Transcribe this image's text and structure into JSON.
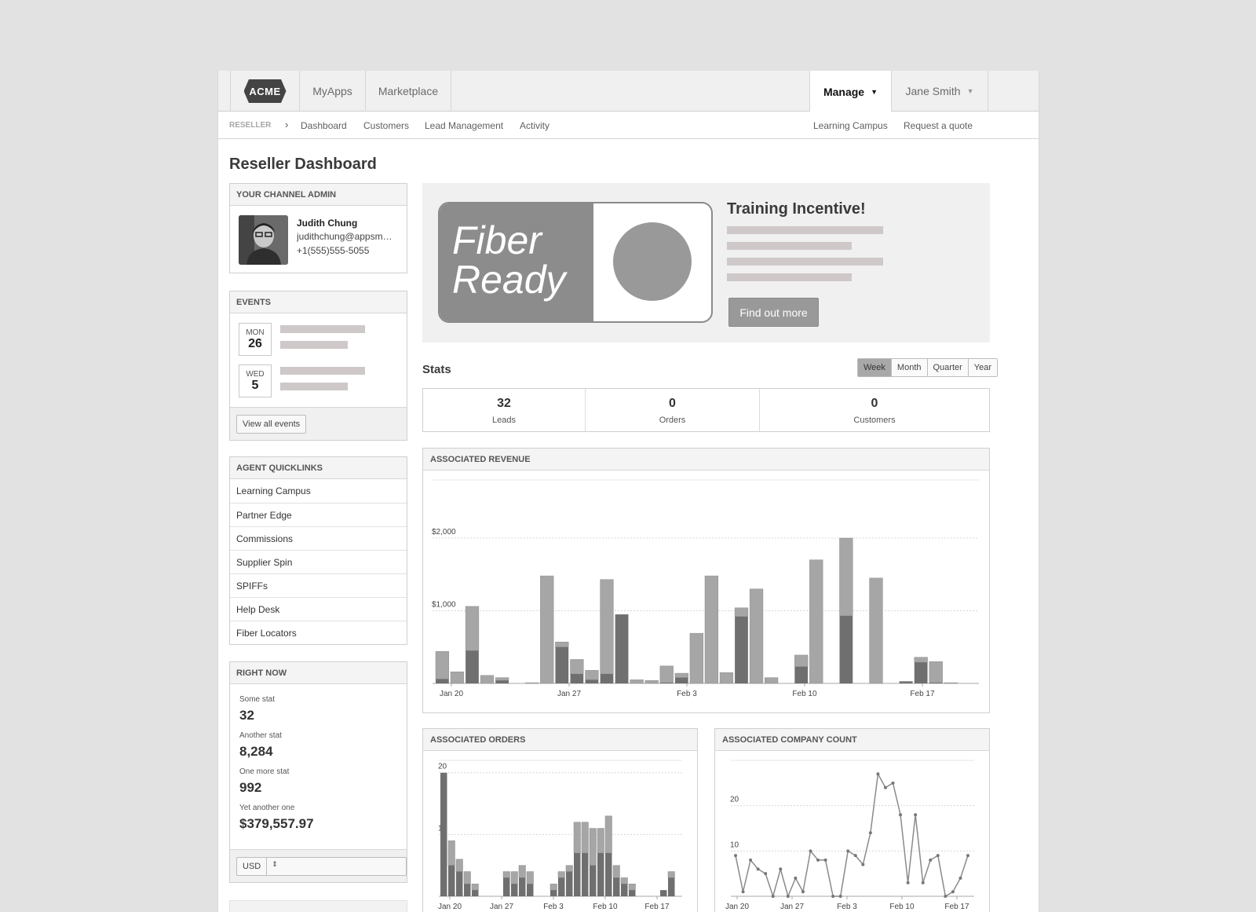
{
  "topnav": {
    "logo_text": "ACME",
    "tabs": [
      "MyApps",
      "Marketplace"
    ],
    "manage_label": "Manage",
    "user_label": "Jane Smith"
  },
  "subnav": {
    "section": "RESELLER",
    "items": [
      "Dashboard",
      "Customers",
      "Lead Management",
      "Activity"
    ],
    "right_links": [
      "Learning Campus",
      "Request a quote"
    ]
  },
  "page_title": "Reseller Dashboard",
  "channel_admin": {
    "heading": "YOUR CHANNEL ADMIN",
    "name": "Judith Chung",
    "email": "judithchung@appsm…",
    "phone": "+1(555)555-5055"
  },
  "events": {
    "heading": "EVENTS",
    "items": [
      {
        "weekday": "MON",
        "day": "26"
      },
      {
        "weekday": "WED",
        "day": "5"
      }
    ],
    "view_all_label": "View all events"
  },
  "quicklinks": {
    "heading": "AGENT QUICKLINKS",
    "items": [
      "Learning Campus",
      "Partner Edge",
      "Commissions",
      "Supplier Spin",
      "SPIFFs",
      "Help Desk",
      "Fiber Locators"
    ]
  },
  "right_now": {
    "heading": "RIGHT NOW",
    "stats": [
      {
        "label": "Some stat",
        "value": "32"
      },
      {
        "label": "Another stat",
        "value": "8,284"
      },
      {
        "label": "One more stat",
        "value": "992"
      },
      {
        "label": "Yet another one",
        "value": "$379,557.97"
      }
    ],
    "currency": "USD"
  },
  "promo": {
    "logo_line1": "Fiber",
    "logo_line2": "Ready",
    "title": "Training Incentive!",
    "button_label": "Find out more"
  },
  "stats": {
    "title": "Stats",
    "periods": [
      "Week",
      "Month",
      "Quarter",
      "Year"
    ],
    "selected_period": "Week",
    "cells": [
      {
        "value": "32",
        "label": "Leads"
      },
      {
        "value": "0",
        "label": "Orders"
      },
      {
        "value": "0",
        "label": "Customers"
      }
    ]
  },
  "colors": {
    "bar_light": "#a6a6a6",
    "bar_dark": "#6f6f6f",
    "line": "#8a8a8a"
  },
  "chart_data": [
    {
      "type": "bar",
      "title": "ASSOCIATED REVENUE",
      "x_ticks": [
        "Jan 20",
        "Jan 27",
        "Feb 3",
        "Feb 10",
        "Feb 17"
      ],
      "y_ticks": [
        "$1,000",
        "$2,000"
      ],
      "ylim": [
        0,
        2800
      ],
      "stacked": true,
      "series": [
        {
          "values": [
            60,
            0,
            450,
            0,
            40,
            0,
            0,
            0,
            500,
            130,
            50,
            130,
            950,
            0,
            0,
            10,
            80,
            0,
            0,
            0,
            920,
            0,
            0,
            0,
            230,
            0,
            0,
            930,
            0,
            0,
            0,
            20,
            290,
            10,
            0
          ]
        },
        {
          "values": [
            380,
            160,
            610,
            110,
            40,
            0,
            10,
            1480,
            70,
            200,
            130,
            1300,
            0,
            50,
            40,
            230,
            60,
            690,
            1480,
            150,
            120,
            1300,
            80,
            0,
            160,
            1700,
            0,
            1070,
            0,
            1450,
            0,
            10,
            70,
            290,
            10,
            0
          ]
        }
      ]
    },
    {
      "type": "bar",
      "title": "ASSOCIATED ORDERS",
      "x_ticks": [
        "Jan 20",
        "Jan 27",
        "Feb 3",
        "Feb 10",
        "Feb 17"
      ],
      "y_ticks": [
        "10",
        "20"
      ],
      "ylim": [
        0,
        22
      ],
      "stacked": true,
      "values_dark": [
        20,
        5,
        4,
        2,
        1,
        0,
        0,
        0,
        3,
        2,
        3,
        2,
        0,
        0,
        1,
        3,
        4,
        7,
        7,
        5,
        7,
        7,
        3,
        2,
        1,
        0,
        0,
        0,
        1,
        3
      ],
      "values_light": [
        0,
        4,
        2,
        2,
        1,
        0,
        0,
        0,
        1,
        2,
        2,
        2,
        0,
        0,
        1,
        1,
        1,
        5,
        5,
        6,
        4,
        6,
        2,
        1,
        1,
        0,
        0,
        0,
        0,
        1
      ]
    },
    {
      "type": "line",
      "title": "ASSOCIATED COMPANY COUNT",
      "x_ticks": [
        "Jan 20",
        "Jan 27",
        "Feb 3",
        "Feb 10",
        "Feb 17"
      ],
      "y_ticks": [
        "10",
        "20"
      ],
      "ylim": [
        0,
        30
      ],
      "values": [
        9,
        1,
        8,
        6,
        5,
        0,
        6,
        0,
        4,
        1,
        10,
        8,
        8,
        0,
        0,
        10,
        9,
        7,
        14,
        27,
        24,
        25,
        18,
        3,
        18,
        3,
        8,
        9,
        0,
        1,
        4,
        9
      ]
    }
  ]
}
